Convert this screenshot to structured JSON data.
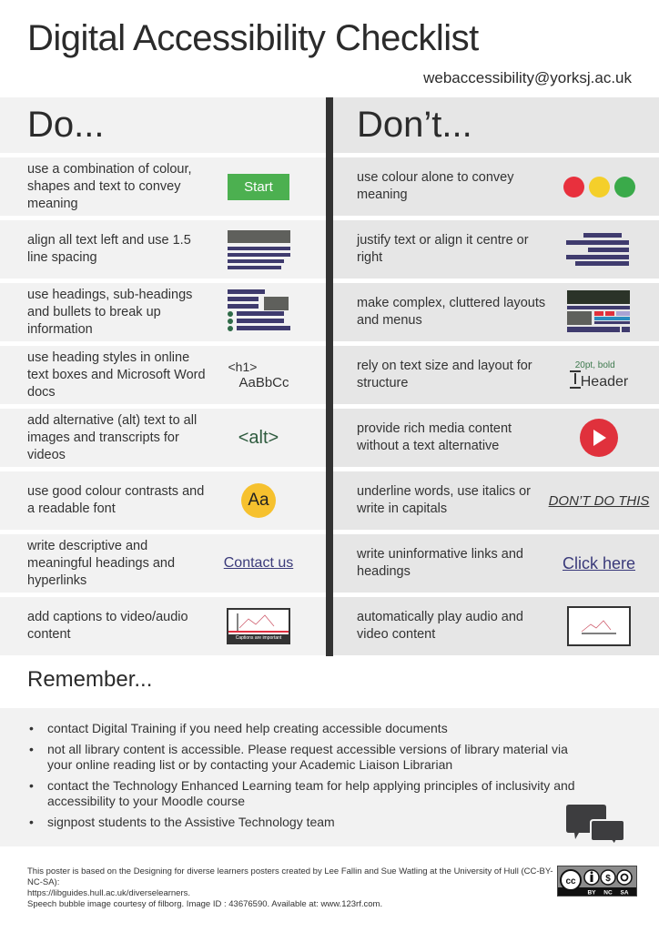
{
  "header": {
    "title": "Digital Accessibility Checklist",
    "email": "webaccessibility@yorksj.ac.uk"
  },
  "do": {
    "heading": "Do...",
    "items": [
      {
        "text": "use a combination of colour, shapes and text to convey meaning",
        "visual": "Start"
      },
      {
        "text": "align all text left and use 1.5 line spacing",
        "visual": "left-aligned-text-icon"
      },
      {
        "text": "use headings, sub-headings and bullets to break up information",
        "visual": "headings-bullets-icon"
      },
      {
        "text": "use heading styles in online text boxes and Microsoft Word docs",
        "visual_line1": "<h1>",
        "visual_line2": "AaBbCc"
      },
      {
        "text": "add alternative (alt) text to all images and transcripts for videos",
        "visual": "<alt>"
      },
      {
        "text": "use good colour contrasts and a readable font",
        "visual": "Aa"
      },
      {
        "text": "write descriptive and meaningful headings and hyperlinks",
        "visual": "Contact us"
      },
      {
        "text": "add captions to video/audio content",
        "visual": "Captions are important"
      }
    ]
  },
  "dont": {
    "heading": "Don’t...",
    "items": [
      {
        "text": "use colour alone to convey meaning",
        "visual": "traffic-light-dots-icon",
        "colors": [
          "#e8303d",
          "#f4cf2a",
          "#3aaa4a"
        ]
      },
      {
        "text": "justify text or align it centre or right",
        "visual": "centred-text-icon"
      },
      {
        "text": "make complex, cluttered layouts and menus",
        "visual": "cluttered-layout-icon"
      },
      {
        "text": "rely on text size and layout for structure",
        "visual_small": "20pt, bold",
        "visual": "Header"
      },
      {
        "text": "provide rich media content without a text alternative",
        "visual": "play-icon"
      },
      {
        "text": "underline words, use italics or write in capitals",
        "visual": "DON’T DO THIS"
      },
      {
        "text": "write uninformative links and headings",
        "visual": "Click here"
      },
      {
        "text": "automatically play audio and video content",
        "visual": "video-frame-icon"
      }
    ]
  },
  "remember": {
    "heading": "Remember...",
    "items": [
      "contact Digital Training if you need help creating accessible documents",
      "not all library content is accessible. Please request accessible versions of library material via your online reading list or by contacting your Academic Liaison Librarian",
      "contact the Technology Enhanced Learning team for help applying principles of inclusivity and accessibility to your Moodle course",
      "signpost students to the Assistive Technology team"
    ]
  },
  "footer": {
    "line1": "This poster is based on the Designing for diverse learners posters created by Lee Fallin and Sue Watling at the University of Hull (CC-BY-NC-SA):",
    "line2": "https://libguides.hull.ac.uk/diverselearners.",
    "line3": "Speech bubble image courtesy of filborg. Image ID : 43676590. Available at: www.123rf.com.",
    "license": {
      "labels": [
        "BY",
        "NC",
        "SA"
      ],
      "badge": "cc"
    }
  },
  "colors": {
    "start_green": "#4cb050",
    "bar_navy": "#3f3b6e",
    "block_grey": "#5f605c",
    "bullet_green": "#2f6b48",
    "aa_yellow": "#f6c12e",
    "play_red": "#e0313c",
    "divider": "#333333"
  }
}
